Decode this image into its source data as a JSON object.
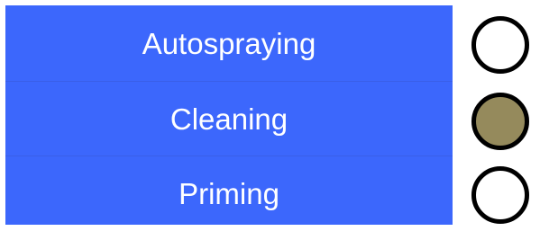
{
  "panel": {
    "background": "#3c67fc",
    "text_color": "#ffffff"
  },
  "modes": [
    {
      "label": "Autospraying",
      "indicator": "off",
      "indicator_color": "#ffffff"
    },
    {
      "label": "Cleaning",
      "indicator": "on",
      "indicator_color": "#958a5c"
    },
    {
      "label": "Priming",
      "indicator": "off",
      "indicator_color": "#ffffff"
    }
  ],
  "indicator_icon": "status-lamp-icon"
}
